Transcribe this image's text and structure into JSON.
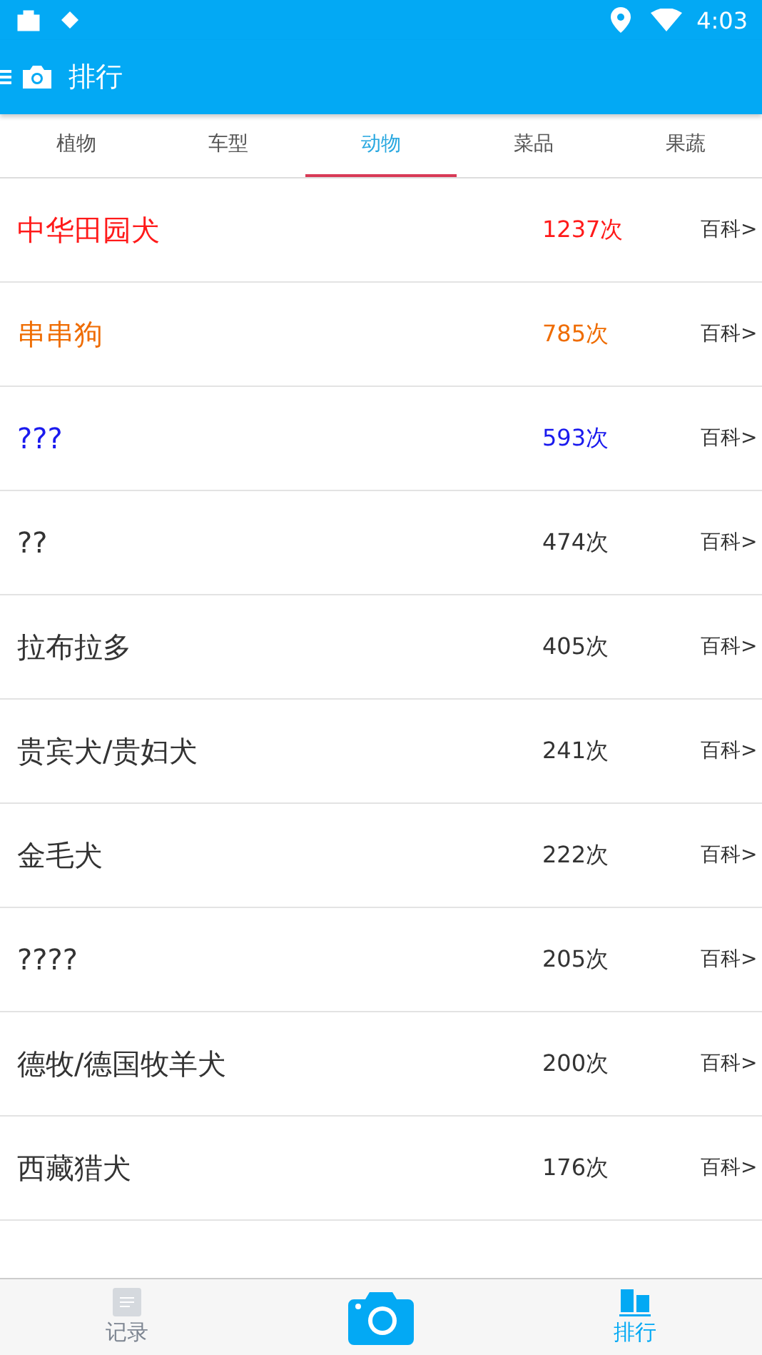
{
  "status_bar": {
    "time": "4:03"
  },
  "app_bar": {
    "title": "排行"
  },
  "tabs": [
    {
      "label": "植物",
      "selected": false
    },
    {
      "label": "车型",
      "selected": false
    },
    {
      "label": "动物",
      "selected": true
    },
    {
      "label": "菜品",
      "selected": false
    },
    {
      "label": "果蔬",
      "selected": false
    }
  ],
  "ranking": [
    {
      "name": "中华田园犬",
      "count": "1237次",
      "link": "百科>",
      "color": "#ff1a1a"
    },
    {
      "name": "串串狗",
      "count": "785次",
      "link": "百科>",
      "color": "#ef6c00"
    },
    {
      "name": "???",
      "count": "593次",
      "link": "百科>",
      "color": "#1a1aee"
    },
    {
      "name": "??",
      "count": "474次",
      "link": "百科>",
      "color": "#333333"
    },
    {
      "name": "拉布拉多",
      "count": "405次",
      "link": "百科>",
      "color": "#333333"
    },
    {
      "name": "贵宾犬/贵妇犬",
      "count": "241次",
      "link": "百科>",
      "color": "#333333"
    },
    {
      "name": "金毛犬",
      "count": "222次",
      "link": "百科>",
      "color": "#333333"
    },
    {
      "name": "????",
      "count": "205次",
      "link": "百科>",
      "color": "#333333"
    },
    {
      "name": "德牧/德国牧羊犬",
      "count": "200次",
      "link": "百科>",
      "color": "#333333"
    },
    {
      "name": "西藏猎犬",
      "count": "176次",
      "link": "百科>",
      "color": "#333333"
    }
  ],
  "bottom_nav": [
    {
      "kind": "record",
      "label": "记录",
      "selected": false
    },
    {
      "kind": "camera",
      "selected": false
    },
    {
      "kind": "ranking",
      "label": "排行",
      "selected": true
    }
  ]
}
